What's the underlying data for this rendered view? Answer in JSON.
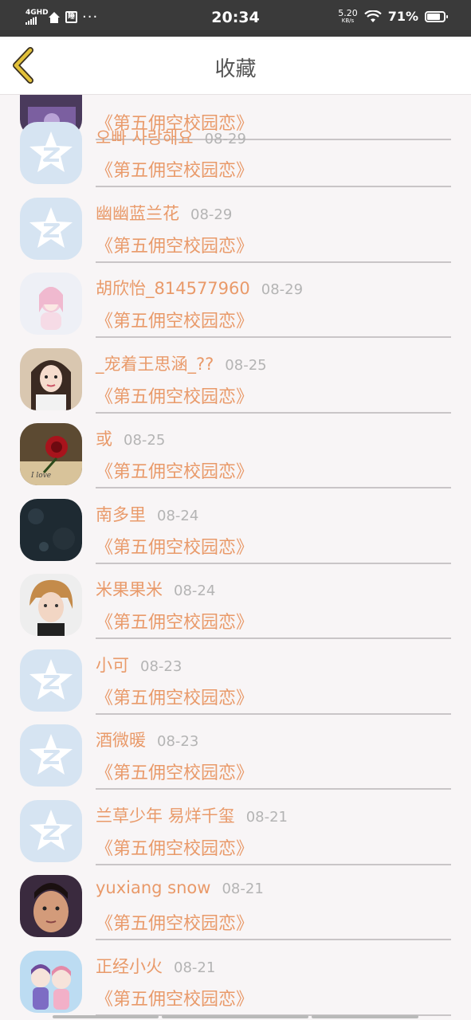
{
  "status_bar": {
    "network": "4GHD",
    "time": "20:34",
    "speed": "5.20",
    "speed_unit": "KB/s",
    "battery": "71%",
    "dots": "···"
  },
  "header": {
    "title": "收藏",
    "back_icon": "chevron-left-icon"
  },
  "favorites": [
    {
      "name": "",
      "date": "",
      "book": "《第五佣空校园恋》",
      "avatar": "photo-purple"
    },
    {
      "name": "오빠 사랑해요",
      "date": "08-29",
      "book": "《第五佣空校园恋》",
      "avatar": "qq-default"
    },
    {
      "name": "幽幽蓝兰花",
      "date": "08-29",
      "book": "《第五佣空校园恋》",
      "avatar": "qq-default"
    },
    {
      "name": "胡欣怡_814577960",
      "date": "08-29",
      "book": "《第五佣空校园恋》",
      "avatar": "anime-girl-pink"
    },
    {
      "name": "_宠着王思涵_??",
      "date": "08-25",
      "book": "《第五佣空校园恋》",
      "avatar": "girl-selfie"
    },
    {
      "name": "或",
      "date": "08-25",
      "book": "《第五佣空校园恋》",
      "avatar": "red-rose"
    },
    {
      "name": "南多里",
      "date": "08-24",
      "book": "《第五佣空校园恋》",
      "avatar": "dark-texture"
    },
    {
      "name": "米果果米",
      "date": "08-24",
      "book": "《第五佣空校园恋》",
      "avatar": "boy-portrait"
    },
    {
      "name": "小可",
      "date": "08-23",
      "book": "《第五佣空校园恋》",
      "avatar": "qq-default"
    },
    {
      "name": "酒微暖",
      "date": "08-23",
      "book": "《第五佣空校园恋》",
      "avatar": "qq-default"
    },
    {
      "name": "兰草少年 易烊千玺",
      "date": "08-21",
      "book": "《第五佣空校园恋》",
      "avatar": "qq-default"
    },
    {
      "name": "yuxiang snow",
      "date": "08-21",
      "book": "《第五佣空校园恋》",
      "avatar": "man-face"
    },
    {
      "name": "正经小火",
      "date": "08-21",
      "book": "《第五佣空校园恋》",
      "avatar": "anime-couple"
    }
  ],
  "colors": {
    "accent_text": "#e99a6a",
    "date_text": "#b4b4b4",
    "back_arrow": "#d9b62b",
    "status_bar_bg": "#3a3a3a"
  }
}
